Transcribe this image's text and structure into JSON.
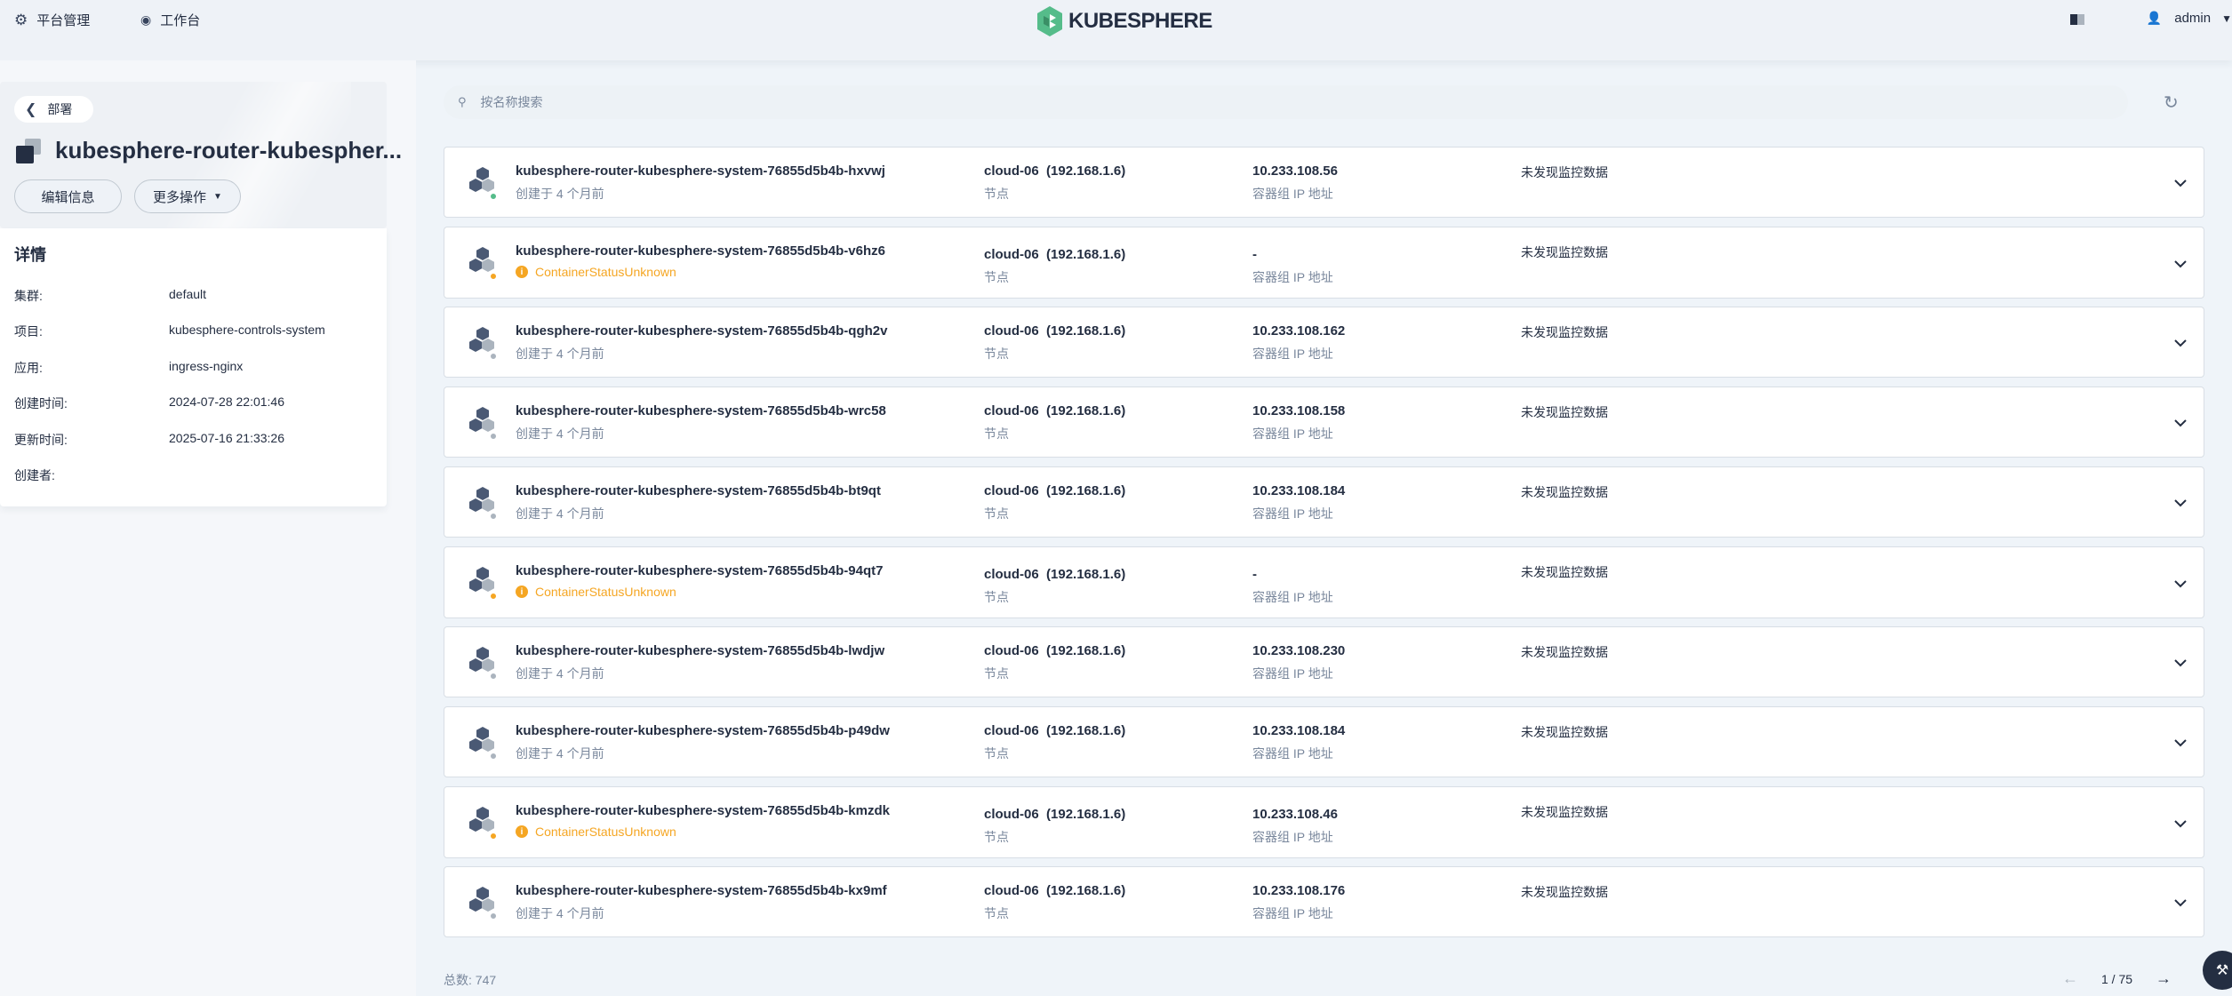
{
  "topbar": {
    "platform_label": "平台管理",
    "workbench_label": "工作台",
    "logo_text": "KUBESPHERE",
    "user_name": "admin"
  },
  "sidebar": {
    "back_label": "部署",
    "resource_title": "kubesphere-router-kubespher...",
    "edit_button": "编辑信息",
    "more_button": "更多操作",
    "details_title": "详情",
    "details": [
      {
        "key": "集群:",
        "value": "default"
      },
      {
        "key": "项目:",
        "value": "kubesphere-controls-system"
      },
      {
        "key": "应用:",
        "value": "ingress-nginx"
      },
      {
        "key": "创建时间:",
        "value": "2024-07-28 22:01:46"
      },
      {
        "key": "更新时间:",
        "value": "2025-07-16 21:33:26"
      },
      {
        "key": "创建者:",
        "value": ""
      }
    ]
  },
  "search": {
    "placeholder": "按名称搜索"
  },
  "pods": [
    {
      "name": "kubesphere-router-kubesphere-system-76855d5b4b-hxvwj",
      "sub": "创建于 4 个月前",
      "warn": false,
      "status_color": "#55bc8a",
      "node": "cloud-06  (192.168.1.6)",
      "node_label": "节点",
      "ip": "10.233.108.56",
      "ip_label": "容器组 IP 地址",
      "monitor": "未发现监控数据"
    },
    {
      "name": "kubesphere-router-kubesphere-system-76855d5b4b-v6hz6",
      "sub": "ContainerStatusUnknown",
      "warn": true,
      "status_color": "#f5a623",
      "node": "cloud-06  (192.168.1.6)",
      "node_label": "节点",
      "ip": "-",
      "ip_label": "容器组 IP 地址",
      "monitor": "未发现监控数据"
    },
    {
      "name": "kubesphere-router-kubesphere-system-76855d5b4b-qgh2v",
      "sub": "创建于 4 个月前",
      "warn": false,
      "status_color": "#abb4be",
      "node": "cloud-06  (192.168.1.6)",
      "node_label": "节点",
      "ip": "10.233.108.162",
      "ip_label": "容器组 IP 地址",
      "monitor": "未发现监控数据"
    },
    {
      "name": "kubesphere-router-kubesphere-system-76855d5b4b-wrc58",
      "sub": "创建于 4 个月前",
      "warn": false,
      "status_color": "#abb4be",
      "node": "cloud-06  (192.168.1.6)",
      "node_label": "节点",
      "ip": "10.233.108.158",
      "ip_label": "容器组 IP 地址",
      "monitor": "未发现监控数据"
    },
    {
      "name": "kubesphere-router-kubesphere-system-76855d5b4b-bt9qt",
      "sub": "创建于 4 个月前",
      "warn": false,
      "status_color": "#abb4be",
      "node": "cloud-06  (192.168.1.6)",
      "node_label": "节点",
      "ip": "10.233.108.184",
      "ip_label": "容器组 IP 地址",
      "monitor": "未发现监控数据"
    },
    {
      "name": "kubesphere-router-kubesphere-system-76855d5b4b-94qt7",
      "sub": "ContainerStatusUnknown",
      "warn": true,
      "status_color": "#f5a623",
      "node": "cloud-06  (192.168.1.6)",
      "node_label": "节点",
      "ip": "-",
      "ip_label": "容器组 IP 地址",
      "monitor": "未发现监控数据"
    },
    {
      "name": "kubesphere-router-kubesphere-system-76855d5b4b-lwdjw",
      "sub": "创建于 4 个月前",
      "warn": false,
      "status_color": "#abb4be",
      "node": "cloud-06  (192.168.1.6)",
      "node_label": "节点",
      "ip": "10.233.108.230",
      "ip_label": "容器组 IP 地址",
      "monitor": "未发现监控数据"
    },
    {
      "name": "kubesphere-router-kubesphere-system-76855d5b4b-p49dw",
      "sub": "创建于 4 个月前",
      "warn": false,
      "status_color": "#abb4be",
      "node": "cloud-06  (192.168.1.6)",
      "node_label": "节点",
      "ip": "10.233.108.184",
      "ip_label": "容器组 IP 地址",
      "monitor": "未发现监控数据"
    },
    {
      "name": "kubesphere-router-kubesphere-system-76855d5b4b-kmzdk",
      "sub": "ContainerStatusUnknown",
      "warn": true,
      "status_color": "#f5a623",
      "node": "cloud-06  (192.168.1.6)",
      "node_label": "节点",
      "ip": "10.233.108.46",
      "ip_label": "容器组 IP 地址",
      "monitor": "未发现监控数据"
    },
    {
      "name": "kubesphere-router-kubesphere-system-76855d5b4b-kx9mf",
      "sub": "创建于 4 个月前",
      "warn": false,
      "status_color": "#abb4be",
      "node": "cloud-06  (192.168.1.6)",
      "node_label": "节点",
      "ip": "10.233.108.176",
      "ip_label": "容器组 IP 地址",
      "monitor": "未发现监控数据"
    }
  ],
  "footer": {
    "total_label": "总数:  747",
    "page_label": "1 / 75"
  },
  "colors": {
    "brand": "#55bc8a",
    "warning": "#f5a623",
    "text": "#242e42",
    "muted": "#79879c"
  }
}
